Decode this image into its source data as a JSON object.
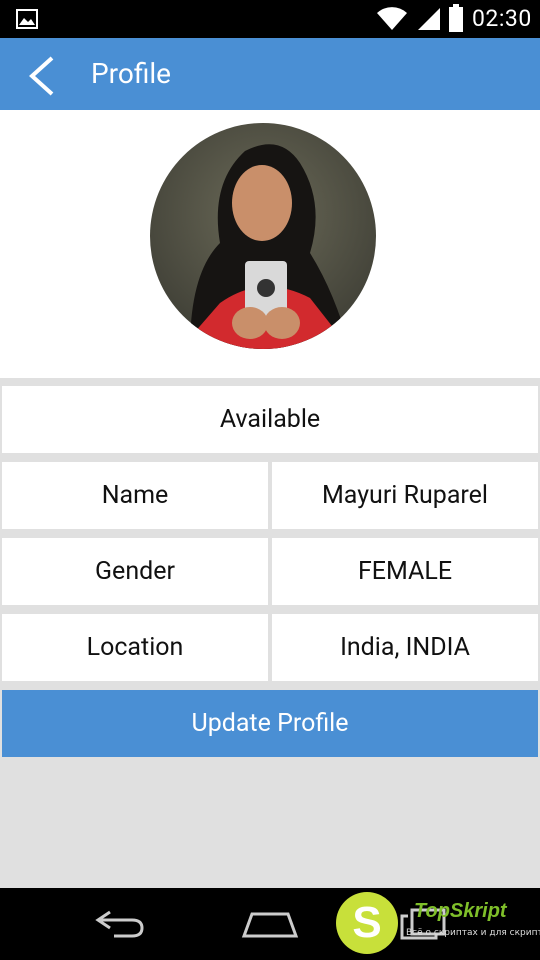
{
  "status_bar": {
    "time": "02:30",
    "icons": [
      "gallery-icon",
      "wifi-icon",
      "signal-icon",
      "battery-icon"
    ]
  },
  "app_bar": {
    "title": "Profile",
    "back_icon": "chevron-left-icon",
    "color": "#4a8fd4"
  },
  "profile": {
    "status": "Available",
    "fields": [
      {
        "label": "Name",
        "value": "Mayuri Ruparel"
      },
      {
        "label": "Gender",
        "value": "FEMALE"
      },
      {
        "label": "Location",
        "value": "India, INDIA"
      }
    ]
  },
  "actions": {
    "update_label": "Update Profile"
  },
  "nav_bar": {
    "icons": [
      "back-nav-icon",
      "home-nav-icon",
      "recents-nav-icon"
    ]
  },
  "watermark": {
    "logo_letter": "S",
    "name": "TopSkript",
    "tagline": "Всё о скриптах и для скриптов..."
  },
  "colors": {
    "primary": "#4a8fd4",
    "background": "#e0e0e0",
    "card": "#ffffff"
  }
}
